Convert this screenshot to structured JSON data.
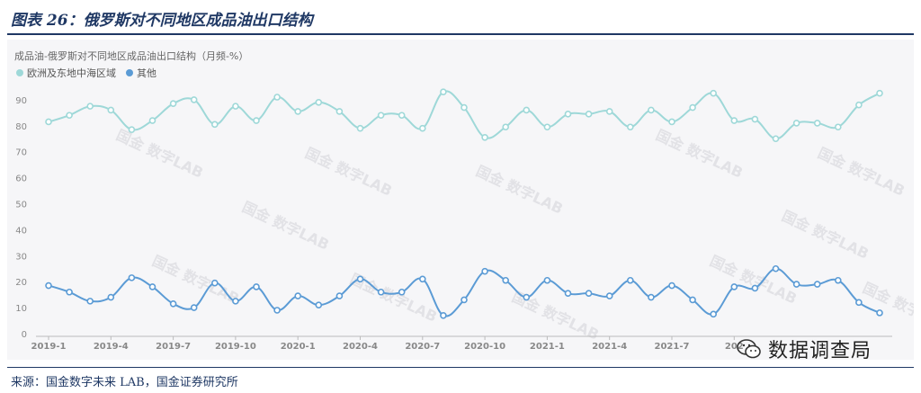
{
  "figure": {
    "title": "图表 26：俄罗斯对不同地区成品油出口结构",
    "source": "来源：国金数字未来 LAB，国金证券研究所",
    "watermark": "国金 数字LAB",
    "wechat_label": "数据调查局"
  },
  "chart_data": {
    "type": "line",
    "title": "成品油-俄罗斯对不同地区成品油出口结构（月频-%）",
    "xlabel": "",
    "ylabel": "",
    "ylim": [
      0,
      100
    ],
    "yticks": [
      0,
      10,
      20,
      30,
      40,
      50,
      60,
      70,
      80,
      90
    ],
    "xtick_labels": [
      "2019-1",
      "2019-4",
      "2019-7",
      "2019-10",
      "2020-1",
      "2020-4",
      "2020-7",
      "2020-10",
      "2021-1",
      "2021-4",
      "2021-7",
      "202"
    ],
    "xtick_index": [
      0,
      3,
      6,
      9,
      12,
      15,
      18,
      21,
      24,
      27,
      30,
      33
    ],
    "grid": false,
    "legend_position": "top-left",
    "series": [
      {
        "name": "欧洲及东地中海区域",
        "color": "#9ed8d8",
        "values": [
          81.5,
          84,
          87.5,
          86,
          78.5,
          82,
          88.5,
          90,
          80.5,
          87.5,
          82,
          91,
          85.5,
          89,
          85.5,
          79,
          84,
          84,
          79,
          93,
          87,
          75.5,
          79.5,
          86,
          79.5,
          84.5,
          84.5,
          85.5,
          79.5,
          86,
          81.5,
          87,
          92.5,
          82,
          82.5,
          75,
          81,
          81,
          79.5,
          88,
          92.5
        ]
      },
      {
        "name": "其他",
        "color": "#5b9bd5",
        "values": [
          18.5,
          16,
          12.5,
          14,
          21.5,
          18,
          11.5,
          10,
          19.5,
          12.5,
          18,
          9,
          14.5,
          11,
          14.5,
          21,
          16,
          16,
          21,
          7,
          13,
          24,
          20.5,
          14,
          20.5,
          15.5,
          15.5,
          14.5,
          20.5,
          14,
          18.5,
          13,
          7.5,
          18,
          17.5,
          25,
          19,
          19,
          20.5,
          12,
          8
        ]
      }
    ]
  }
}
